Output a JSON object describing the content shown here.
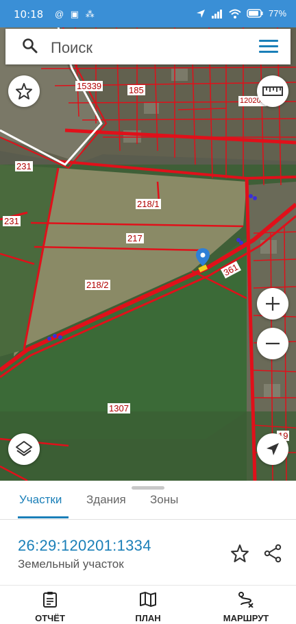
{
  "status_bar": {
    "time": "10:18",
    "left_icons": "@ ▣ ⁂",
    "battery": "77"
  },
  "search": {
    "placeholder": "Поиск"
  },
  "map": {
    "parcel_labels": [
      "15339",
      "185",
      "120201",
      "231",
      "231",
      "218/1",
      "217",
      "218/2",
      "361",
      "1307",
      "19"
    ]
  },
  "sheet": {
    "tabs": [
      "Участки",
      "Здания",
      "Зоны"
    ],
    "active_tab": "Участки",
    "cadastral_number": "26:29:120201:1334",
    "object_type": "Земельный участок"
  },
  "nav": {
    "report": "ОТЧЁТ",
    "plan": "ПЛАН",
    "route": "МАРШРУТ"
  },
  "colors": {
    "accent": "#1a7fb8",
    "parcel_line": "#e0101a",
    "status_bar": "#3a8fd6"
  }
}
